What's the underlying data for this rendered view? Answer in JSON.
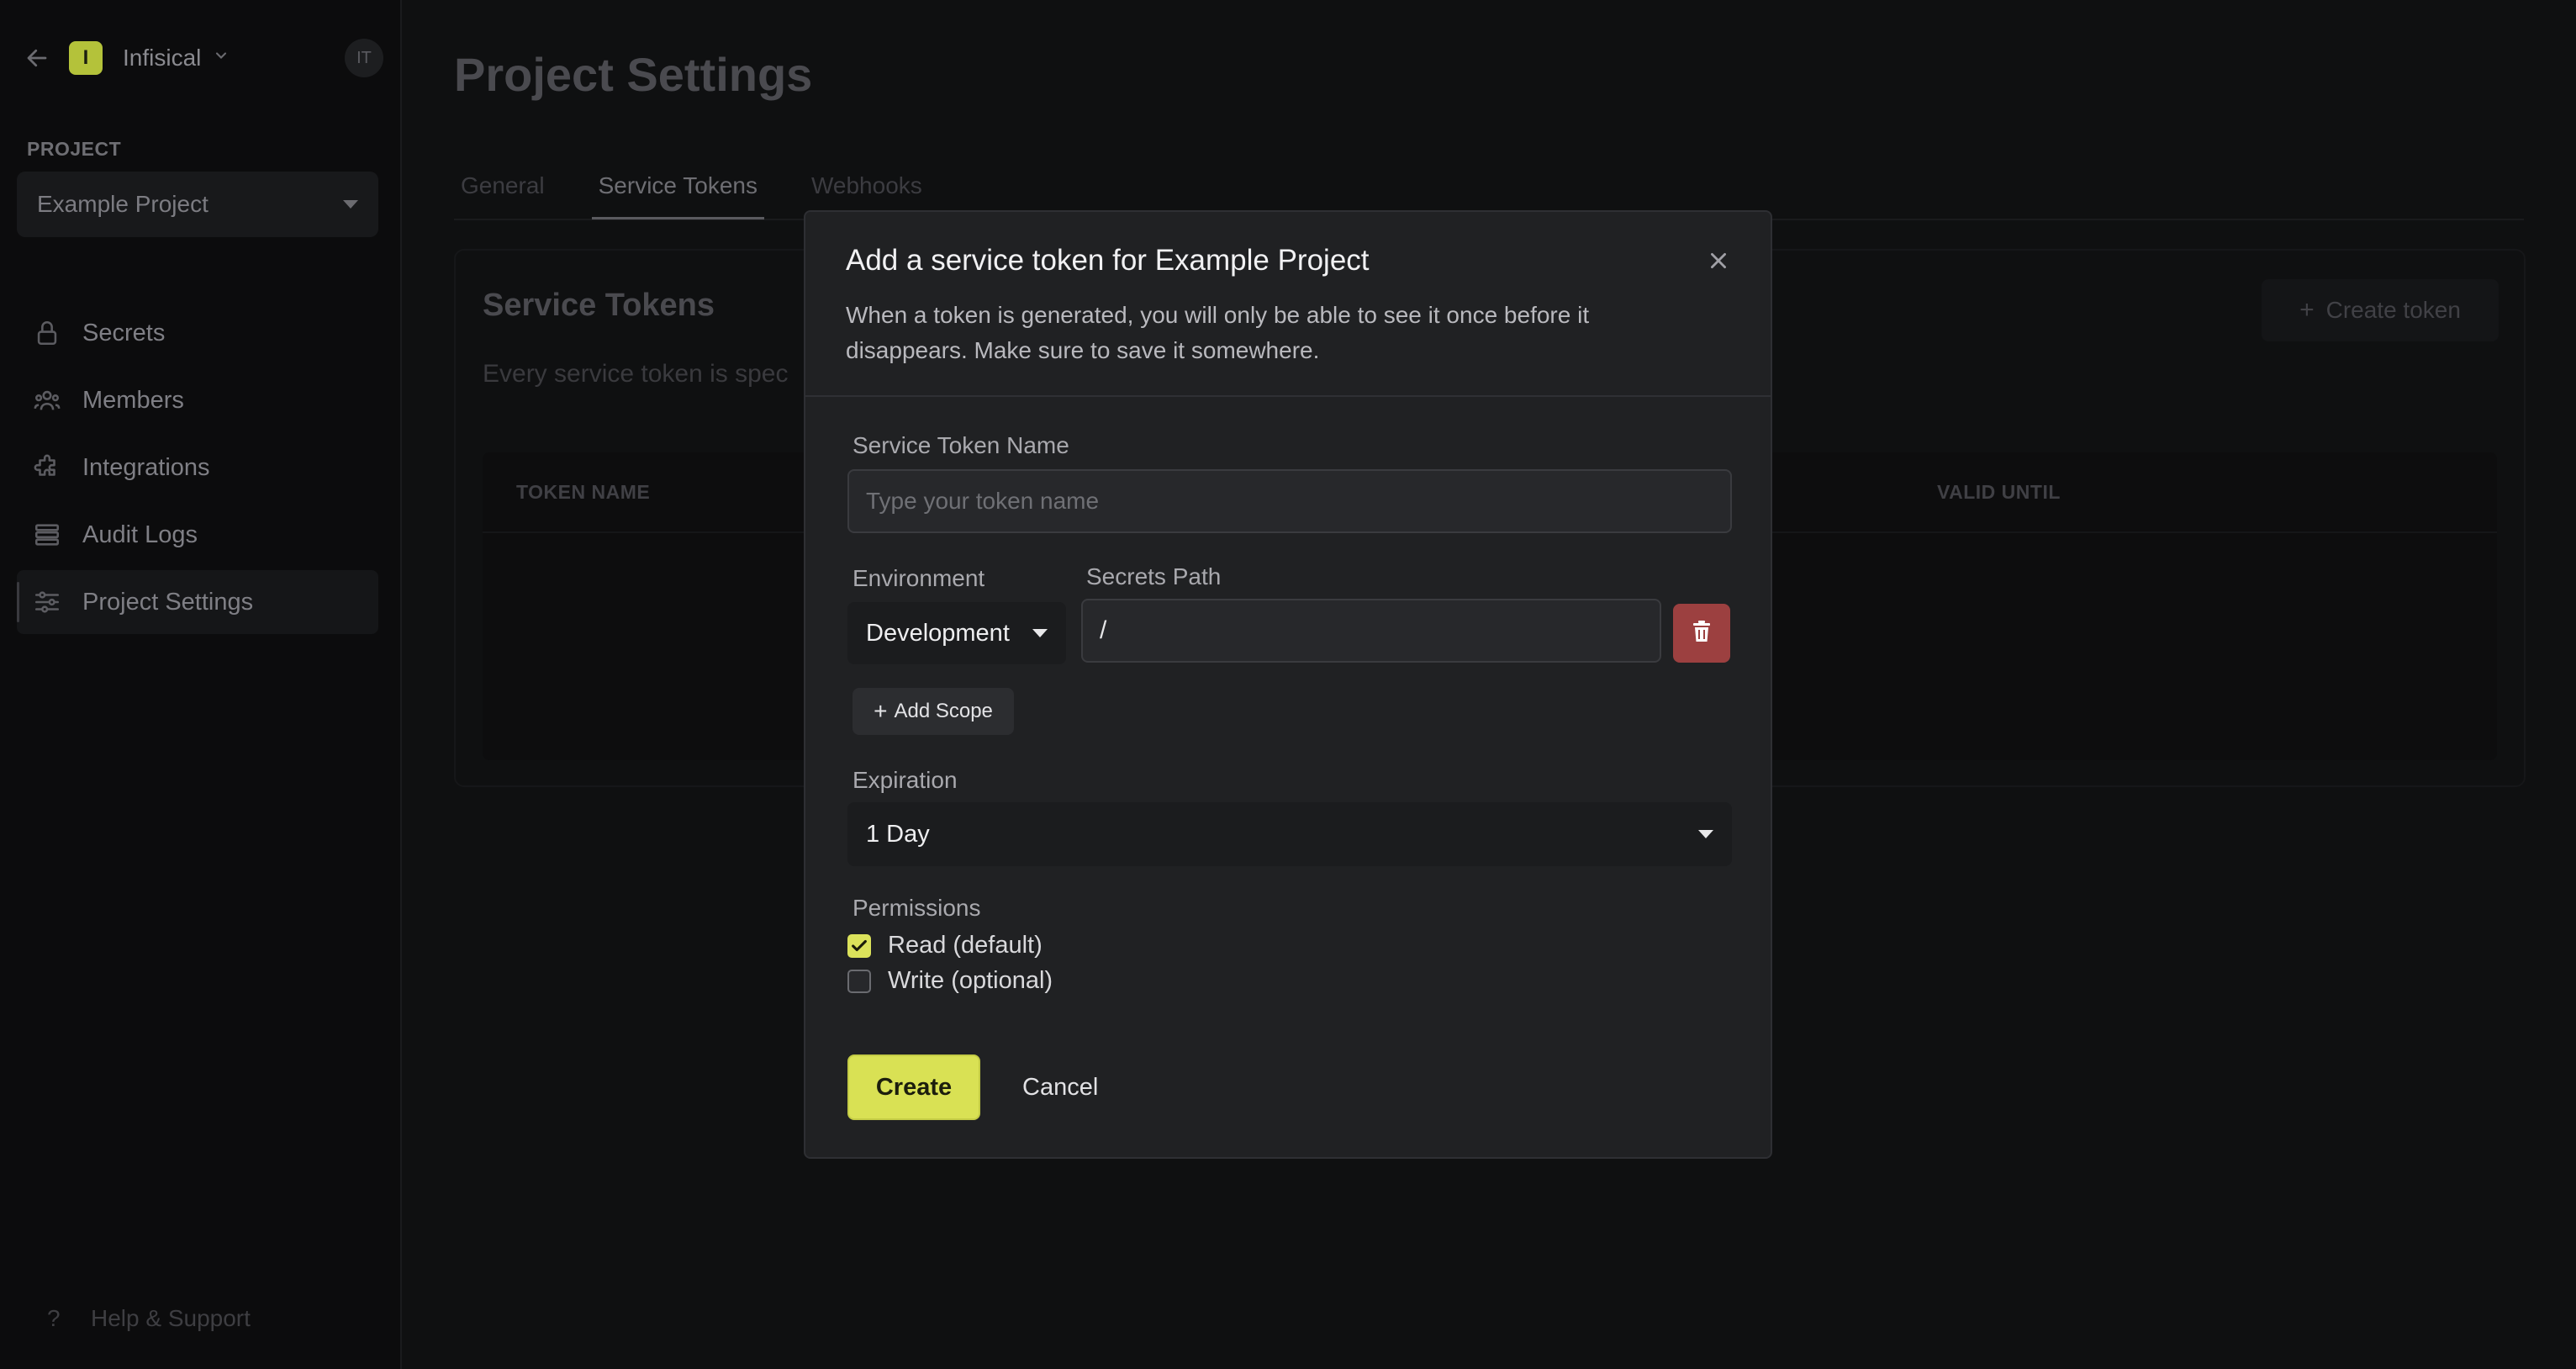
{
  "sidebar": {
    "org_initial": "I",
    "org_name": "Infisical",
    "user_initials": "IT",
    "project_label": "PROJECT",
    "project_selected": "Example Project",
    "nav": [
      {
        "label": "Secrets",
        "icon": "lock-icon"
      },
      {
        "label": "Members",
        "icon": "users-icon"
      },
      {
        "label": "Integrations",
        "icon": "puzzle-icon"
      },
      {
        "label": "Audit Logs",
        "icon": "list-icon"
      },
      {
        "label": "Project Settings",
        "icon": "sliders-icon",
        "active": true
      }
    ],
    "help_label": "Help & Support",
    "help_icon": "?"
  },
  "main": {
    "title": "Project Settings",
    "tabs": [
      {
        "label": "General"
      },
      {
        "label": "Service Tokens",
        "active": true
      },
      {
        "label": "Webhooks"
      }
    ],
    "card": {
      "title": "Service Tokens",
      "description": "Every service token is spec",
      "create_button": "Create token",
      "table_headers": [
        "TOKEN NAME",
        "VALID UNTIL"
      ]
    }
  },
  "modal": {
    "title": "Add a service token for Example Project",
    "subtitle": "When a token is generated, you will only be able to see it once before it disappears. Make sure to save it somewhere.",
    "name_label": "Service Token Name",
    "name_placeholder": "Type your token name",
    "name_value": "",
    "environment_label": "Environment",
    "environment_value": "Development",
    "secrets_path_label": "Secrets Path",
    "secrets_path_value": "/",
    "add_scope_label": "Add Scope",
    "expiration_label": "Expiration",
    "expiration_value": "1 Day",
    "permissions_label": "Permissions",
    "permissions": [
      {
        "label": "Read (default)",
        "checked": true
      },
      {
        "label": "Write (optional)",
        "checked": false
      }
    ],
    "create_label": "Create",
    "cancel_label": "Cancel"
  },
  "colors": {
    "accent": "#d9e154",
    "danger": "#9c4040",
    "modal_bg": "#202123",
    "page_bg": "#0f1011"
  }
}
